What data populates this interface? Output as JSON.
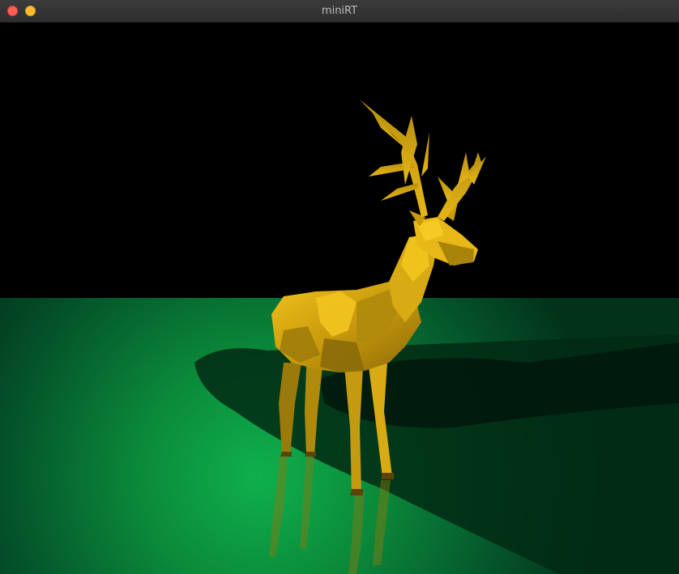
{
  "window": {
    "title": "miniRT"
  },
  "icons": {
    "close": "close-dot-icon",
    "minimize": "minimize-dot-icon"
  },
  "colors": {
    "close": "#ff5f57",
    "minimize": "#febc2e",
    "floor": "#0a8a3a",
    "deer": "#c9a010"
  }
}
